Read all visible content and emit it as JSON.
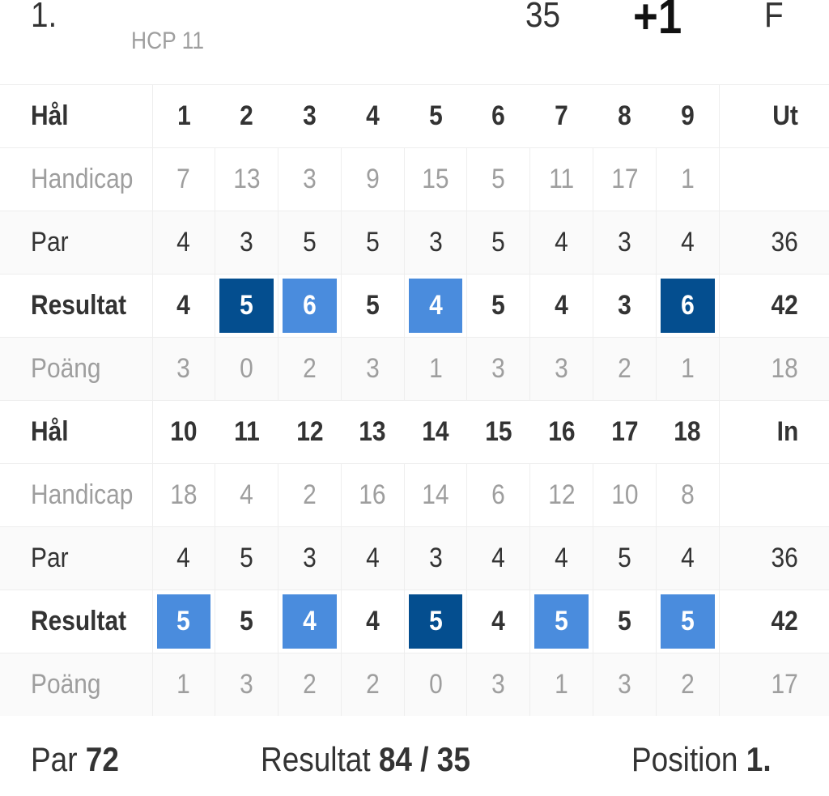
{
  "player": {
    "position": "1.",
    "hcp_label": "HCP 11",
    "points": "35",
    "to_par": "+1",
    "status": "F"
  },
  "colors": {
    "bogey": "#4a8cdd",
    "double_bogey_or_worse": "#044e8f",
    "muted_text": "#9e9e9e",
    "primary_text": "#333333"
  },
  "row_labels": {
    "hole": "Hål",
    "handicap": "Handicap",
    "par": "Par",
    "result": "Resultat",
    "points": "Poäng"
  },
  "front_nine": {
    "total_label": "Ut",
    "holes": [
      "1",
      "2",
      "3",
      "4",
      "5",
      "6",
      "7",
      "8",
      "9"
    ],
    "handicap": [
      "7",
      "13",
      "3",
      "9",
      "15",
      "5",
      "11",
      "17",
      "1"
    ],
    "par": [
      "4",
      "3",
      "5",
      "5",
      "3",
      "5",
      "4",
      "3",
      "4"
    ],
    "result": [
      "4",
      "5",
      "6",
      "5",
      "4",
      "5",
      "4",
      "3",
      "6"
    ],
    "result_style": [
      "none",
      "double",
      "bogey",
      "none",
      "bogey",
      "none",
      "none",
      "none",
      "double"
    ],
    "points": [
      "3",
      "0",
      "2",
      "3",
      "1",
      "3",
      "3",
      "2",
      "1"
    ],
    "par_total": "36",
    "result_total": "42",
    "points_total": "18"
  },
  "back_nine": {
    "total_label": "In",
    "holes": [
      "10",
      "11",
      "12",
      "13",
      "14",
      "15",
      "16",
      "17",
      "18"
    ],
    "handicap": [
      "18",
      "4",
      "2",
      "16",
      "14",
      "6",
      "12",
      "10",
      "8"
    ],
    "par": [
      "4",
      "5",
      "3",
      "4",
      "3",
      "4",
      "4",
      "5",
      "4"
    ],
    "result": [
      "5",
      "5",
      "4",
      "4",
      "5",
      "4",
      "5",
      "5",
      "5"
    ],
    "result_style": [
      "bogey",
      "none",
      "bogey",
      "none",
      "double",
      "none",
      "bogey",
      "none",
      "bogey"
    ],
    "points": [
      "1",
      "3",
      "2",
      "2",
      "0",
      "3",
      "1",
      "3",
      "2"
    ],
    "par_total": "36",
    "result_total": "42",
    "points_total": "17"
  },
  "footer": {
    "par_label": "Par",
    "par_value": "72",
    "result_label": "Resultat",
    "result_value": "84 / 35",
    "position_label": "Position",
    "position_value": "1."
  }
}
